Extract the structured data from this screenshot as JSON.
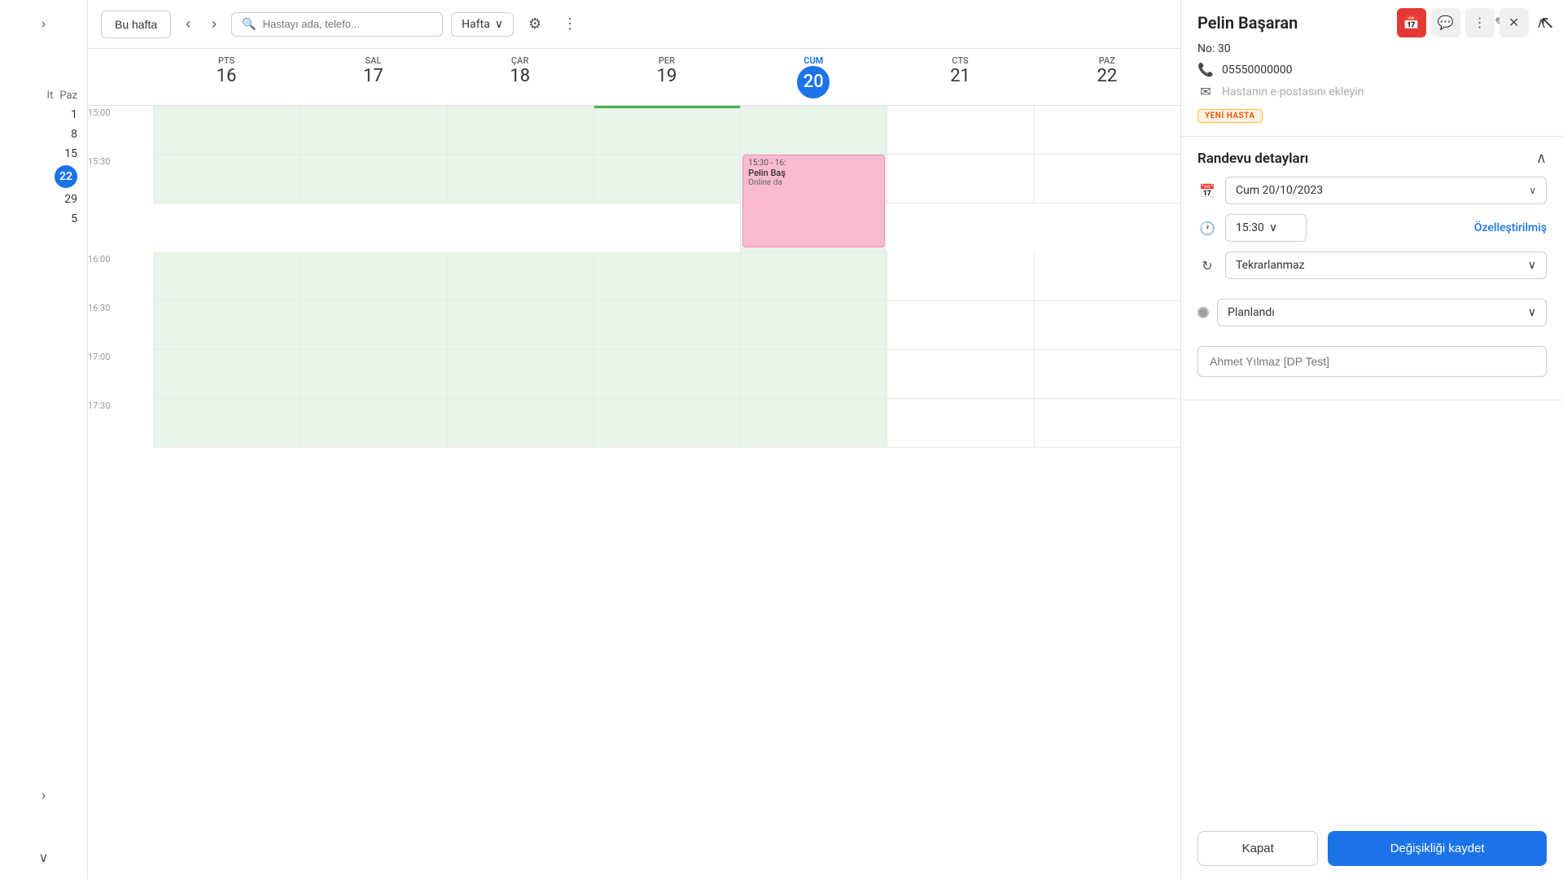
{
  "sidebar": {
    "expand_label": "›",
    "collapse_label": "‹",
    "week_labels": [
      "It",
      "Paz"
    ],
    "dates": [
      {
        "num": "1",
        "today": false
      },
      {
        "num": "8",
        "today": false
      },
      {
        "num": "15",
        "today": false
      },
      {
        "num": "22",
        "today": true
      },
      {
        "num": "29",
        "today": false
      },
      {
        "num": "5",
        "today": false
      }
    ]
  },
  "toolbar": {
    "this_week_label": "Bu hafta",
    "search_placeholder": "Hastayı ada, telefo...",
    "view_label": "Hafta",
    "gear_icon": "⚙",
    "more_icon": "⋮"
  },
  "top_right": {
    "calendar_icon": "📅",
    "chat_icon": "💬",
    "more_icon": "⋮",
    "close_icon": "✕"
  },
  "calendar": {
    "days": [
      {
        "short": "PTS",
        "num": "16",
        "today": false
      },
      {
        "short": "SAL",
        "num": "17",
        "today": false
      },
      {
        "short": "ÇAR",
        "num": "18",
        "today": false
      },
      {
        "short": "PER",
        "num": "19",
        "today": false
      },
      {
        "short": "CUM",
        "num": "20",
        "today": true
      },
      {
        "short": "CTS",
        "num": "21",
        "today": false
      },
      {
        "short": "PAZ",
        "num": "22",
        "today": false
      }
    ],
    "times": [
      "15:00",
      "15:30",
      "16:00",
      "16:30"
    ],
    "appointment": {
      "time_range": "15:30 - 16:",
      "patient": "Pelin Baş",
      "type": "Online da"
    }
  },
  "right_panel": {
    "patient_section": {
      "title": "Pelin Başaran",
      "edit_icon": "✎",
      "external_icon": "↗",
      "collapse_icon": "∧",
      "no_label": "No: 30",
      "phone": "05550000000",
      "phone_icon": "📞",
      "email_icon": "✉",
      "email_placeholder": "Hastanın e-postasını ekleyin",
      "badge": "YENİ HASTA"
    },
    "appointment_section": {
      "title": "Randevu detayları",
      "collapse_icon": "∧",
      "calendar_icon": "📅",
      "date_value": "Cum 20/10/2023",
      "clock_icon": "🕐",
      "time_value": "15:30",
      "custom_label": "Özelleştirilmiş",
      "repeat_icon": "↻",
      "repeat_value": "Tekrarlanmaz",
      "status_value": "Planlandı",
      "doctor_placeholder": "Ahmet Yılmaz [DP Test]"
    },
    "footer": {
      "cancel_label": "Kapat",
      "save_label": "Değişikliği kaydet"
    }
  }
}
